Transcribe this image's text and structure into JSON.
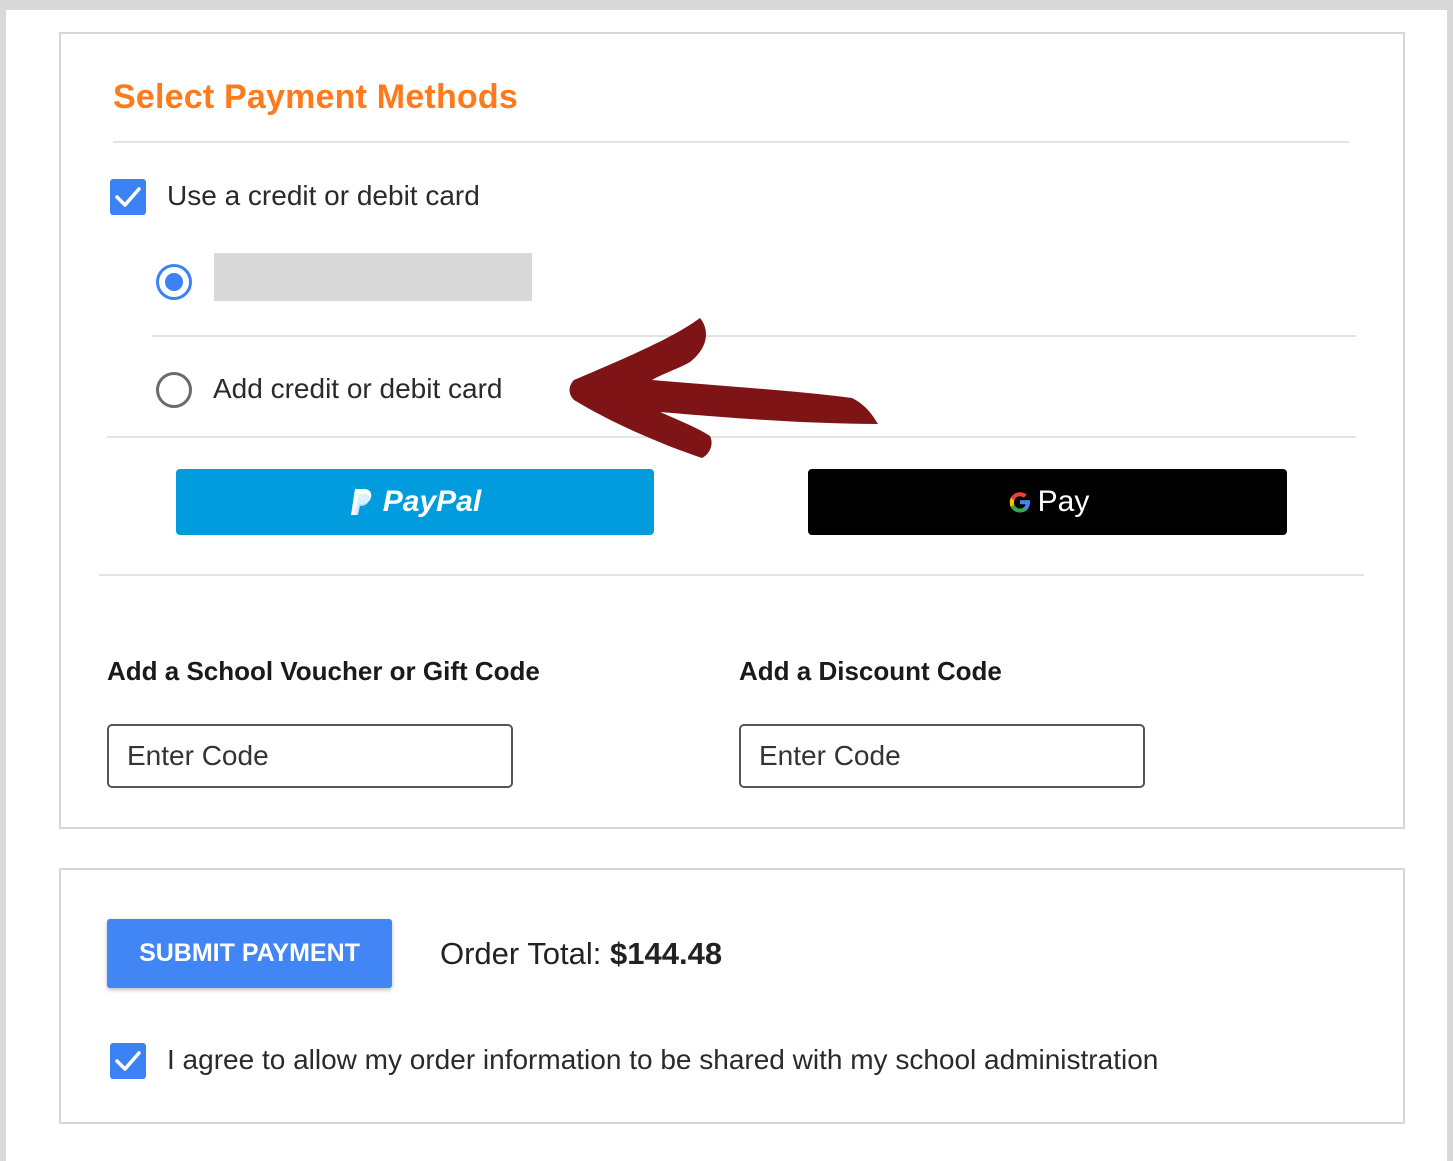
{
  "payment": {
    "title": "Select Payment Methods",
    "use_card_label": "Use a credit or debit card",
    "use_card_checked": true,
    "saved_card_selected": true,
    "add_card_label": "Add credit or debit card",
    "paypal_label": "PayPal",
    "gpay_label": "Pay"
  },
  "codes": {
    "voucher_label": "Add a School Voucher or Gift Code",
    "voucher_placeholder": "Enter Code",
    "discount_label": "Add a Discount Code",
    "discount_placeholder": "Enter Code"
  },
  "submit": {
    "button_label": "SUBMIT PAYMENT",
    "order_total_label": "Order Total:",
    "order_total_value": "$144.48",
    "agree_label": "I agree to allow my order information to be shared with my school administration",
    "agree_checked": true
  },
  "colors": {
    "accent": "#3b82f6",
    "title": "#ff7a1a",
    "paypal": "#009cde",
    "annotation_arrow": "#7f1416"
  }
}
